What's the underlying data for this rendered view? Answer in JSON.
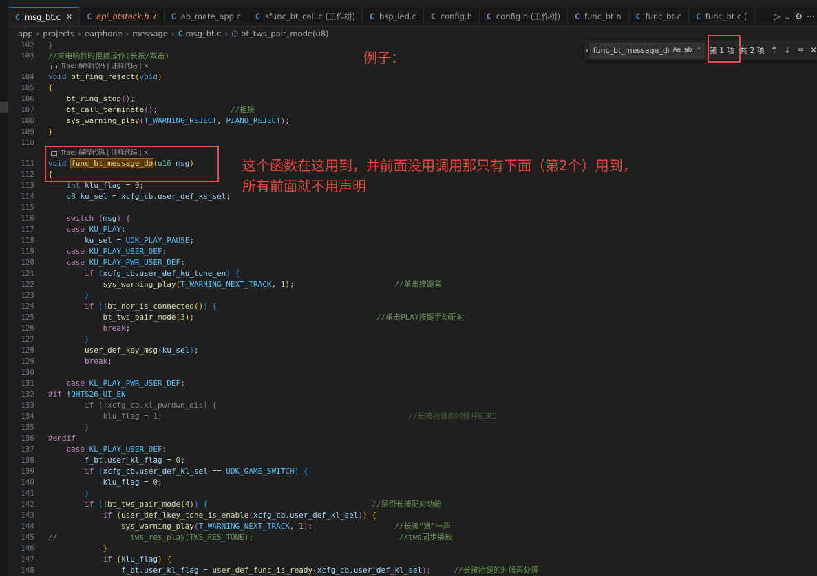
{
  "tabs": [
    {
      "label": "msg_bt.c",
      "kind": "c",
      "active": true,
      "close": true
    },
    {
      "label": "api_btstack.h",
      "kind": "h",
      "italic": true,
      "badge": "7"
    },
    {
      "label": "ab_mate_app.c",
      "kind": "c"
    },
    {
      "label": "sfunc_bt_call.c (工作树)",
      "kind": "c"
    },
    {
      "label": "bsp_led.c",
      "kind": "c"
    },
    {
      "label": "config.h",
      "kind": "h"
    },
    {
      "label": "config.h (工作树)",
      "kind": "h"
    },
    {
      "label": "func_bt.h",
      "kind": "h"
    },
    {
      "label": "func_bt.c",
      "kind": "c"
    },
    {
      "label": "func_bt.c (",
      "kind": "c"
    }
  ],
  "tab_actions": {
    "run_icon": "play-icon",
    "dropdown_icon": "chevron-down-icon",
    "settings_icon": "gear-icon"
  },
  "breadcrumb": [
    "app",
    "projects",
    "earphone",
    "message",
    "msg_bt.c",
    "bt_tws_pair_mode(u8)"
  ],
  "find_widget": {
    "query": "func_bt_message_do",
    "options": [
      "Aa",
      "ab",
      "·*"
    ],
    "match_current": "第 1 项",
    "match_total": "共 2 项"
  },
  "codelens": "Trae: 解释代码 | 注释代码 | ✕",
  "annotations": {
    "example": "例子：",
    "note_line1": "这个函数在这用到，并前面没用调用那只有下面（第2个）用到，",
    "note_line2": "所有前面就不用声明"
  },
  "colors": {
    "annotation": "#e8463a",
    "match_highlight": "#613a00",
    "accent": "#0078d4"
  },
  "code": [
    {
      "n": "102",
      "t": [
        [
          "",
          "cm",
          "}"
        ]
      ]
    },
    {
      "n": "103",
      "t": [
        [
          "//来电响铃时拒接操作(长按/双击)",
          "cm"
        ]
      ],
      "lens_after": true
    },
    {
      "n": "104",
      "t": [
        [
          "void ",
          "kw"
        ],
        [
          "bt_ring_reject",
          "fn"
        ],
        [
          "(",
          "br1"
        ],
        [
          "void",
          "kw"
        ],
        [
          ")",
          "br1"
        ]
      ]
    },
    {
      "n": "105",
      "t": [
        [
          "{",
          "br1"
        ]
      ]
    },
    {
      "n": "106",
      "t": [
        [
          "    "
        ],
        [
          "bt_ring_stop",
          "fn"
        ],
        [
          "(",
          "br2"
        ],
        [
          ")",
          "br2"
        ],
        [
          ";"
        ]
      ]
    },
    {
      "n": "107",
      "t": [
        [
          "    "
        ],
        [
          "bt_call_terminate",
          "fn"
        ],
        [
          "(",
          "br2"
        ],
        [
          ")",
          "br2"
        ],
        [
          ";"
        ],
        [
          "                "
        ],
        [
          "//拒接",
          "cm"
        ]
      ]
    },
    {
      "n": "108",
      "t": [
        [
          "    "
        ],
        [
          "sys_warning_play",
          "fn"
        ],
        [
          "(",
          "br2"
        ],
        [
          "T_WARNING_REJECT",
          "mac"
        ],
        [
          ", "
        ],
        [
          "PIANO_REJECT",
          "mac"
        ],
        [
          ")",
          "br2"
        ],
        [
          ";"
        ]
      ]
    },
    {
      "n": "109",
      "t": [
        [
          "}",
          "br1"
        ]
      ]
    },
    {
      "n": "110",
      "t": [],
      "lens_after": true
    },
    {
      "n": "111",
      "t": [
        [
          "void ",
          "kw"
        ],
        [
          "func_bt_message_do",
          "fn hl"
        ],
        [
          "(",
          "br1"
        ],
        [
          "u16 ",
          "ty"
        ],
        [
          "msg",
          "var"
        ],
        [
          ")",
          "br1"
        ]
      ]
    },
    {
      "n": "112",
      "t": [
        [
          "{",
          "br1"
        ]
      ]
    },
    {
      "n": "113",
      "t": [
        [
          "    "
        ],
        [
          "int ",
          "kw"
        ],
        [
          "klu_flag",
          "var"
        ],
        [
          " = "
        ],
        [
          "0",
          "num"
        ],
        [
          ";"
        ]
      ]
    },
    {
      "n": "114",
      "t": [
        [
          "    "
        ],
        [
          "u8 ",
          "ty"
        ],
        [
          "ku_sel",
          "var"
        ],
        [
          " = "
        ],
        [
          "xcfg_cb",
          "var"
        ],
        [
          "."
        ],
        [
          "user_def_ks_sel",
          "var"
        ],
        [
          ";"
        ]
      ]
    },
    {
      "n": "115",
      "t": []
    },
    {
      "n": "116",
      "t": [
        [
          "    "
        ],
        [
          "switch ",
          "ctl"
        ],
        [
          "(",
          "br2"
        ],
        [
          "msg",
          "var"
        ],
        [
          ")",
          "br2"
        ],
        [
          " "
        ],
        [
          "{",
          "br2"
        ]
      ]
    },
    {
      "n": "117",
      "t": [
        [
          "    "
        ],
        [
          "case ",
          "ctl"
        ],
        [
          "KU_PLAY",
          "mac"
        ],
        [
          ":"
        ]
      ]
    },
    {
      "n": "118",
      "t": [
        [
          "        "
        ],
        [
          "ku_sel",
          "var"
        ],
        [
          " = "
        ],
        [
          "UDK_PLAY_PAUSE",
          "mac"
        ],
        [
          ";"
        ]
      ]
    },
    {
      "n": "119",
      "t": [
        [
          "    "
        ],
        [
          "case ",
          "ctl"
        ],
        [
          "KU_PLAY_USER_DEF",
          "mac"
        ],
        [
          ":"
        ]
      ]
    },
    {
      "n": "120",
      "t": [
        [
          "    "
        ],
        [
          "case ",
          "ctl"
        ],
        [
          "KU_PLAY_PWR_USER_DEF",
          "mac"
        ],
        [
          ":"
        ]
      ]
    },
    {
      "n": "121",
      "t": [
        [
          "        "
        ],
        [
          "if ",
          "ctl"
        ],
        [
          "(",
          "br3"
        ],
        [
          "xcfg_cb",
          "var"
        ],
        [
          "."
        ],
        [
          "user_def_ku_tone_en",
          "var"
        ],
        [
          ")",
          "br3"
        ],
        [
          " "
        ],
        [
          "{",
          "br3"
        ]
      ]
    },
    {
      "n": "122",
      "t": [
        [
          "            "
        ],
        [
          "sys_warning_play",
          "fn"
        ],
        [
          "(",
          "br1"
        ],
        [
          "T_WARNING_NEXT_TRACK",
          "mac"
        ],
        [
          ", "
        ],
        [
          "1",
          "num"
        ],
        [
          ")",
          "br1"
        ],
        [
          ";"
        ],
        [
          "                      "
        ],
        [
          "//单击按键音",
          "cm"
        ]
      ]
    },
    {
      "n": "123",
      "t": [
        [
          "        "
        ],
        [
          "}",
          "br3"
        ]
      ]
    },
    {
      "n": "124",
      "t": [
        [
          "        "
        ],
        [
          "if ",
          "ctl"
        ],
        [
          "(",
          "br3"
        ],
        [
          "!"
        ],
        [
          "bt_nor_is_connected",
          "fn"
        ],
        [
          "(",
          "br1"
        ],
        [
          ")",
          "br1"
        ],
        [
          ")",
          "br3"
        ],
        [
          " "
        ],
        [
          "{",
          "br3"
        ]
      ]
    },
    {
      "n": "125",
      "t": [
        [
          "            "
        ],
        [
          "bt_tws_pair_mode",
          "fn"
        ],
        [
          "(",
          "br1"
        ],
        [
          "3",
          "num"
        ],
        [
          ")",
          "br1"
        ],
        [
          ";"
        ],
        [
          "                                        "
        ],
        [
          "//单击PLAY按键手动配对",
          "cm"
        ]
      ]
    },
    {
      "n": "126",
      "t": [
        [
          "            "
        ],
        [
          "break",
          "ctl"
        ],
        [
          ";"
        ]
      ]
    },
    {
      "n": "127",
      "t": [
        [
          "        "
        ],
        [
          "}",
          "br3"
        ]
      ]
    },
    {
      "n": "128",
      "t": [
        [
          "        "
        ],
        [
          "user_def_key_msg",
          "fn"
        ],
        [
          "(",
          "br3"
        ],
        [
          "ku_sel",
          "var"
        ],
        [
          ")",
          "br3"
        ],
        [
          ";"
        ]
      ]
    },
    {
      "n": "129",
      "t": [
        [
          "        "
        ],
        [
          "break",
          "ctl"
        ],
        [
          ";"
        ]
      ]
    },
    {
      "n": "130",
      "t": []
    },
    {
      "n": "131",
      "t": [
        [
          "    "
        ],
        [
          "case ",
          "ctl"
        ],
        [
          "KL_PLAY_PWR_USER_DEF",
          "mac"
        ],
        [
          ":"
        ]
      ]
    },
    {
      "n": "132",
      "t": [
        [
          "#if ",
          "pp"
        ],
        [
          "!"
        ],
        [
          "QHTS26_UI_EN",
          "mac"
        ]
      ]
    },
    {
      "n": "133",
      "t": [
        [
          "        "
        ],
        [
          "if (!xcfg_cb.kl_pwrdwn_dis) {",
          "dim"
        ]
      ]
    },
    {
      "n": "134",
      "t": [
        [
          "            "
        ],
        [
          "klu_flag = 1;",
          "dim"
        ],
        [
          "                                                      "
        ],
        [
          "//长按抬键的时候呼SIRI",
          "cm dim"
        ]
      ]
    },
    {
      "n": "135",
      "t": [
        [
          "        "
        ],
        [
          "}",
          "dim"
        ]
      ]
    },
    {
      "n": "136",
      "t": [
        [
          "#endif",
          "pp"
        ]
      ]
    },
    {
      "n": "137",
      "t": [
        [
          "    "
        ],
        [
          "case ",
          "ctl"
        ],
        [
          "KL_PLAY_USER_DEF",
          "mac"
        ],
        [
          ":"
        ]
      ]
    },
    {
      "n": "138",
      "t": [
        [
          "        "
        ],
        [
          "f_bt",
          "var"
        ],
        [
          "."
        ],
        [
          "user_kl_flag",
          "var"
        ],
        [
          " = "
        ],
        [
          "0",
          "num"
        ],
        [
          ";"
        ]
      ]
    },
    {
      "n": "139",
      "t": [
        [
          "        "
        ],
        [
          "if ",
          "ctl"
        ],
        [
          "(",
          "br3"
        ],
        [
          "xcfg_cb",
          "var"
        ],
        [
          "."
        ],
        [
          "user_def_kl_sel",
          "var"
        ],
        [
          " == "
        ],
        [
          "UDK_GAME_SWITCH",
          "mac"
        ],
        [
          ")",
          "br3"
        ],
        [
          " "
        ],
        [
          "{",
          "br3"
        ]
      ]
    },
    {
      "n": "140",
      "t": [
        [
          "            "
        ],
        [
          "klu_flag",
          "var"
        ],
        [
          " = "
        ],
        [
          "0",
          "num"
        ],
        [
          ";"
        ]
      ]
    },
    {
      "n": "141",
      "t": [
        [
          "        "
        ],
        [
          "}",
          "br3"
        ]
      ]
    },
    {
      "n": "142",
      "t": [
        [
          "        "
        ],
        [
          "if ",
          "ctl"
        ],
        [
          "(",
          "br3"
        ],
        [
          "!"
        ],
        [
          "bt_tws_pair_mode",
          "fn"
        ],
        [
          "(",
          "br1"
        ],
        [
          "4",
          "num"
        ],
        [
          ")",
          "br1"
        ],
        [
          ")",
          "br3"
        ],
        [
          " "
        ],
        [
          "{",
          "br3"
        ],
        [
          "                                    "
        ],
        [
          "//是否长按配对功能",
          "cm"
        ]
      ]
    },
    {
      "n": "143",
      "t": [
        [
          "            "
        ],
        [
          "if ",
          "ctl"
        ],
        [
          "(",
          "br1"
        ],
        [
          "user_def_lkey_tone_is_enable",
          "fn"
        ],
        [
          "(",
          "br2"
        ],
        [
          "xcfg_cb",
          "var"
        ],
        [
          "."
        ],
        [
          "user_def_kl_sel",
          "var"
        ],
        [
          ")",
          "br2"
        ],
        [
          ")",
          "br1"
        ],
        [
          " "
        ],
        [
          "{",
          "br1"
        ]
      ]
    },
    {
      "n": "144",
      "t": [
        [
          "                "
        ],
        [
          "sys_warning_play",
          "fn"
        ],
        [
          "(",
          "br2"
        ],
        [
          "T_WARNING_NEXT_TRACK",
          "mac"
        ],
        [
          ", "
        ],
        [
          "1",
          "num"
        ],
        [
          ")",
          "br2"
        ],
        [
          ";"
        ],
        [
          "                  "
        ],
        [
          "//长按“滴”一声",
          "cm"
        ]
      ]
    },
    {
      "n": "145",
      "t": [
        [
          "//                tws_res_play(TWS_RES_TONE);                                //tws同步播放",
          "cm"
        ]
      ]
    },
    {
      "n": "146",
      "t": [
        [
          "            "
        ],
        [
          "}",
          "br1"
        ]
      ]
    },
    {
      "n": "147",
      "t": [
        [
          "            "
        ],
        [
          "if ",
          "ctl"
        ],
        [
          "(",
          "br1"
        ],
        [
          "klu_flag",
          "var"
        ],
        [
          ")",
          "br1"
        ],
        [
          " "
        ],
        [
          "{",
          "br1"
        ]
      ]
    },
    {
      "n": "148",
      "t": [
        [
          "                "
        ],
        [
          "f_bt",
          "var"
        ],
        [
          "."
        ],
        [
          "user_kl_flag",
          "var"
        ],
        [
          " = "
        ],
        [
          "user_def_func_is_ready",
          "fn"
        ],
        [
          "(",
          "br2"
        ],
        [
          "xcfg_cb",
          "var"
        ],
        [
          "."
        ],
        [
          "user_def_kl_sel",
          "var"
        ],
        [
          ")",
          "br2"
        ],
        [
          ";"
        ],
        [
          "     "
        ],
        [
          "//长按抬键的时候再处理",
          "cm"
        ]
      ]
    }
  ]
}
